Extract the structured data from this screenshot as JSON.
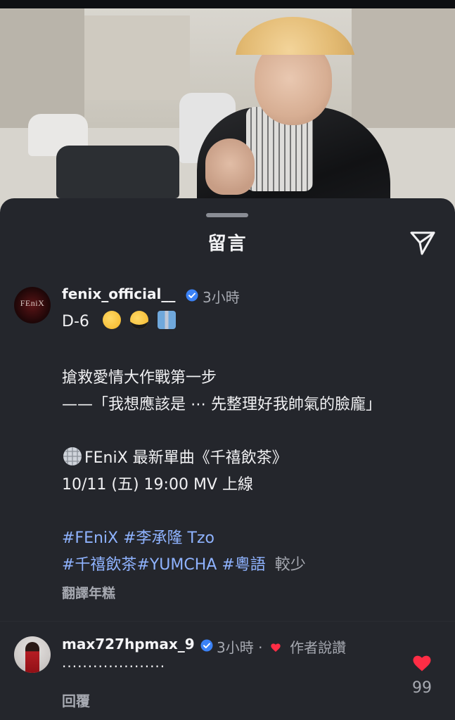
{
  "sheet": {
    "title": "留言"
  },
  "comments": [
    {
      "avatar_text": "FEniX",
      "username": "fenix_official__",
      "time": "3小時",
      "lines": [
        "D-6",
        "搶救愛情大作戰第一步",
        "——「我想應該是 ⋯ 先整理好我帥氣的臉龐」",
        "FEniX 最新單曲《千禧飲茶》",
        " 10/11 (五) 19:00 MV 上線"
      ],
      "tags_line1": [
        "#FEniX",
        "#李承隆 Tzo"
      ],
      "tags_line2": [
        "#千禧飲茶",
        "#YUMCHA",
        "#粵語"
      ],
      "see_less": "較少",
      "translate": "翻譯年糕",
      "emojis": [
        "thinking-face-emoji",
        "sunglasses-face-emoji",
        "necktie-shirt-emoji"
      ]
    },
    {
      "username": "max727hpmax_9",
      "time": "3小時 ·",
      "author_liked": "作者說讚",
      "text": "····················",
      "reply": "回覆",
      "likes": "99"
    }
  ],
  "colors": {
    "sheet_bg": "#24262c",
    "accent_tag": "#8fb3ff",
    "verified": "#3b82f6",
    "heart": "#ff2d45"
  },
  "icons": [
    "send-icon",
    "verified-badge-icon",
    "heart-icon",
    "disco-ball-icon"
  ]
}
